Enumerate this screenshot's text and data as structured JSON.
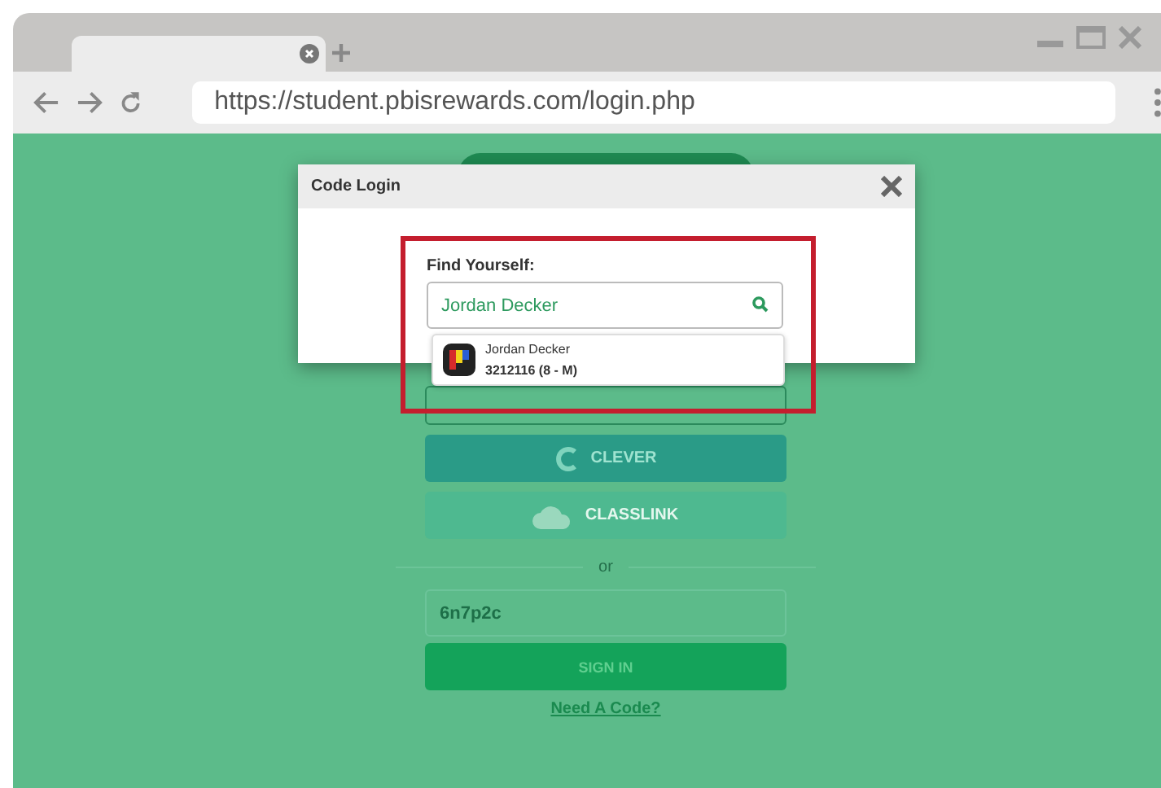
{
  "browser": {
    "url": "https://student.pbisrewards.com/login.php"
  },
  "login_buttons": [
    {
      "kind": "hidden"
    },
    {
      "kind": "clever",
      "label": "CLEVER"
    },
    {
      "kind": "classlink",
      "label": "CLASSLINK"
    }
  ],
  "divider": "or",
  "code_field": {
    "value": "6n7p2c"
  },
  "sign_in": "SIGN IN",
  "help_link": "Need A Code?",
  "modal": {
    "title": "Code Login",
    "label": "Find Yourself:",
    "search_value": "Jordan Decker",
    "results": [
      {
        "name": "Jordan Decker",
        "detail": "3212116 (8 - M)"
      }
    ]
  }
}
